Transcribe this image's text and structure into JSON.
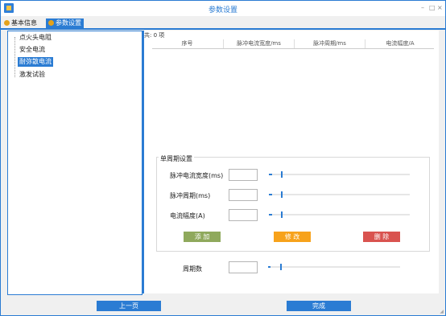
{
  "window": {
    "title": "参数设置",
    "controls": {
      "minimize": "–",
      "maximize": "□",
      "close": "×"
    }
  },
  "tabs": [
    {
      "label": "基本信息",
      "icon": "settings-icon"
    },
    {
      "label": "参数设置",
      "icon": "settings-icon",
      "active": true
    }
  ],
  "tree": {
    "items": [
      {
        "label": "点火头电阻"
      },
      {
        "label": "安全电流"
      },
      {
        "label": "耐弥散电流",
        "selected": true
      },
      {
        "label": "激发试验"
      }
    ]
  },
  "table": {
    "count_text": "共: 0 项",
    "columns": [
      "序号",
      "脉冲电流宽度/ms",
      "脉冲周期/ms",
      "电流幅度/A"
    ]
  },
  "single_period": {
    "group_title": "单周期设置",
    "rows": [
      {
        "label": "脉冲电流宽度(ms)",
        "value": "",
        "slider_level": 0.02
      },
      {
        "label": "脉冲周期(ms)",
        "value": "",
        "slider_level": 0.02
      },
      {
        "label": "电流幅度(A)",
        "value": "",
        "slider_level": 0.02
      }
    ],
    "buttons": {
      "add": "添 加",
      "edit": "修 改",
      "delete": "删 除"
    },
    "colors": {
      "add": "#8fa95c",
      "edit": "#f7a21b",
      "delete": "#d9534f"
    }
  },
  "period_count": {
    "label": "周期数",
    "value": "",
    "slider_level": 0.02
  },
  "footer": {
    "prev": "上一页",
    "finish": "完成"
  },
  "accent": "#2b7cd3"
}
